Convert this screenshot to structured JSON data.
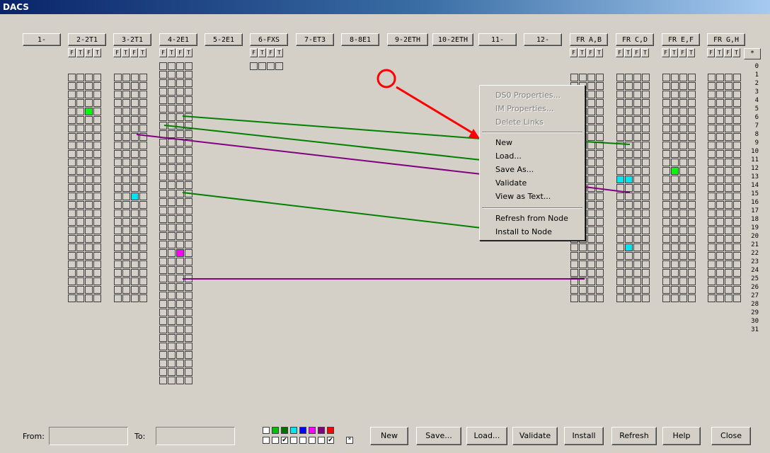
{
  "window": {
    "title": "DACS"
  },
  "slots": [
    {
      "label": "1-",
      "ft": false
    },
    {
      "label": "2-2T1",
      "ft": true
    },
    {
      "label": "3-2T1",
      "ft": true
    },
    {
      "label": "4-2E1",
      "ft": true
    },
    {
      "label": "5-2E1",
      "ft": false
    },
    {
      "label": "6-FXS",
      "ft": true
    },
    {
      "label": "7-ET3",
      "ft": false
    },
    {
      "label": "8-8E1",
      "ft": false
    },
    {
      "label": "9-2ETH",
      "ft": false
    },
    {
      "label": "10-2ETH",
      "ft": false
    },
    {
      "label": "11-",
      "ft": false
    },
    {
      "label": "12-",
      "ft": false
    },
    {
      "label": "FR A,B",
      "ft": true
    },
    {
      "label": "FR C,D",
      "ft": true
    },
    {
      "label": "FR E,F",
      "ft": true
    },
    {
      "label": "FR G,H",
      "ft": true
    }
  ],
  "ft_letters": [
    "F",
    "T"
  ],
  "star_label": "*",
  "row_numbers": [
    "0",
    "1",
    "2",
    "3",
    "4",
    "5",
    "6",
    "7",
    "8",
    "9",
    "10",
    "11",
    "12",
    "13",
    "14",
    "15",
    "16",
    "17",
    "18",
    "19",
    "20",
    "21",
    "22",
    "23",
    "24",
    "25",
    "26",
    "27",
    "28",
    "29",
    "30",
    "31"
  ],
  "context_menu": {
    "items": [
      {
        "label": "DS0 Properties...",
        "enabled": false
      },
      {
        "label": "IM Properties...",
        "enabled": false
      },
      {
        "label": "Delete Links",
        "enabled": false
      },
      {
        "label": "New",
        "enabled": true
      },
      {
        "label": "Load...",
        "enabled": true
      },
      {
        "label": "Save As...",
        "enabled": true
      },
      {
        "label": "Validate",
        "enabled": true
      },
      {
        "label": "View as Text...",
        "enabled": true
      },
      {
        "label": "Refresh from Node",
        "enabled": true
      },
      {
        "label": "Install to Node",
        "enabled": true
      }
    ]
  },
  "bottom": {
    "from_label": "From:",
    "from_value": "",
    "to_label": "To:",
    "to_value": "",
    "swatch_colors": [
      "#ffffff",
      "#00c000",
      "#007000",
      "#00e5ee",
      "#0000ff",
      "#ff00ff",
      "#800080",
      "#ff0000"
    ],
    "swatch_checked": [
      false,
      false,
      true,
      false,
      false,
      false,
      false,
      true
    ],
    "buttons": {
      "new": "New",
      "save": "Save...",
      "load": "Load...",
      "validate": "Validate",
      "install": "Install",
      "refresh": "Refresh",
      "help": "Help",
      "close": "Close"
    }
  },
  "colors": {
    "accent_green": "#008000",
    "accent_purple": "#800080",
    "annotation_red": "#ff0000"
  }
}
